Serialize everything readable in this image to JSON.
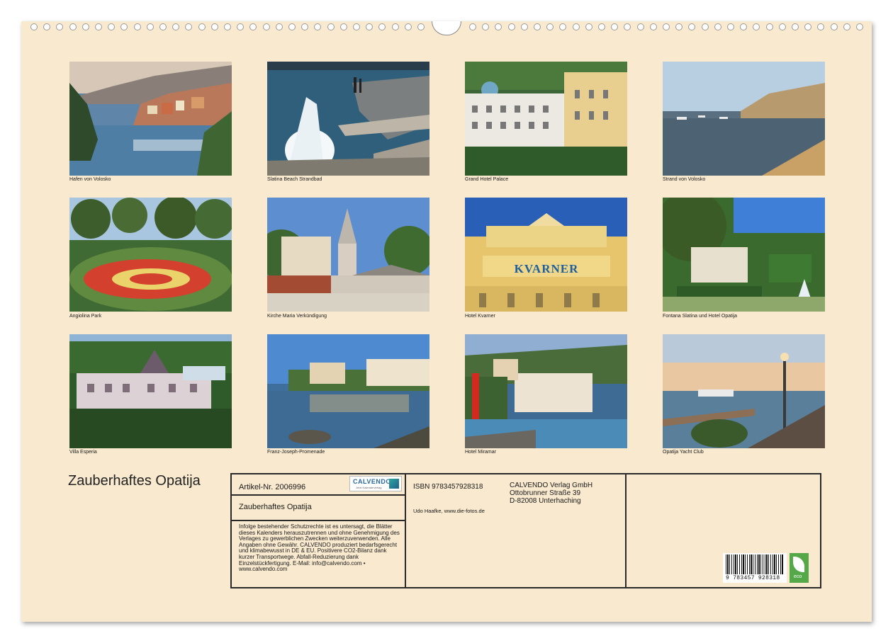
{
  "photos": [
    {
      "caption": "Hafen von Volosko"
    },
    {
      "caption": "Slatina Beach Strandbad"
    },
    {
      "caption": "Grand Hotel Palace"
    },
    {
      "caption": "Strand von Volosko"
    },
    {
      "caption": "Angiolina Park"
    },
    {
      "caption": "Kirche Maria Verkündigung"
    },
    {
      "caption": "Hotel Kvarner"
    },
    {
      "caption": "Fontana Slatina und Hotel Opatija"
    },
    {
      "caption": "Villa Esperia"
    },
    {
      "caption": "Franz-Joseph-Promenade"
    },
    {
      "caption": "Hotel Miramar"
    },
    {
      "caption": "Opatija Yacht Club"
    }
  ],
  "hotel_sign": "KVARNER",
  "title": "Zauberhaftes Opatija",
  "info": {
    "article": "Artikel-Nr. 2006996",
    "logo_word": "CALVENDO",
    "logo_sub": "Jetzt Kalenderverlag",
    "box_title": "Zauberhaftes Opatija",
    "legal": "Infolge bestehender Schutzrechte ist es untersagt, die Blätter dieses Kalenders herauszutrennen und ohne Genehmigung des Verlages zu gewerblichen Zwecken weiterzuverwenden. Alle Angaben ohne Gewähr. CALVENDO produziert bedarfsgerecht und klimabewusst in DE & EU. Positivere CO2-Bilanz dank kurzer Transportwege. Abfall-Reduzierung dank Einzelstückfertigung. E-Mail: info@calvendo.com • www.calvendo.com",
    "isbn": "ISBN 9783457928318",
    "author": "Udo Haafke, www.die-fotos.de",
    "publisher_name": "CALVENDO Verlag GmbH",
    "publisher_street": "Ottobrunner Straße 39",
    "publisher_city": "D-82008 Unterhaching",
    "barcode_number": "9 783457 928318",
    "eco_label": "eco"
  }
}
